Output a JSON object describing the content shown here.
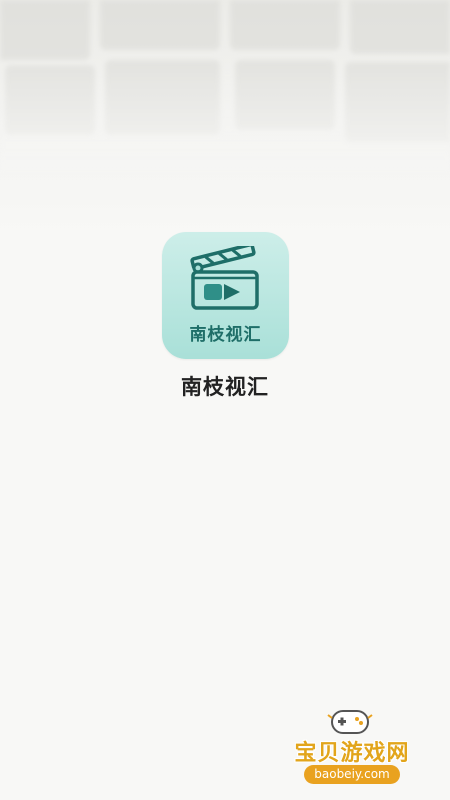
{
  "app": {
    "icon_label": "南枝视汇",
    "name": "南枝视汇"
  },
  "icons": {
    "app_icon": "clapperboard-play-icon",
    "watermark_icon": "gamepad-icon"
  },
  "watermark": {
    "title": "宝贝游戏网",
    "url": "baobeiy.com"
  },
  "colors": {
    "icon_bg_top": "#cdeee9",
    "icon_bg_bottom": "#a9e0d8",
    "icon_accent": "#1e6e68",
    "watermark_orange": "#e9a21f"
  }
}
